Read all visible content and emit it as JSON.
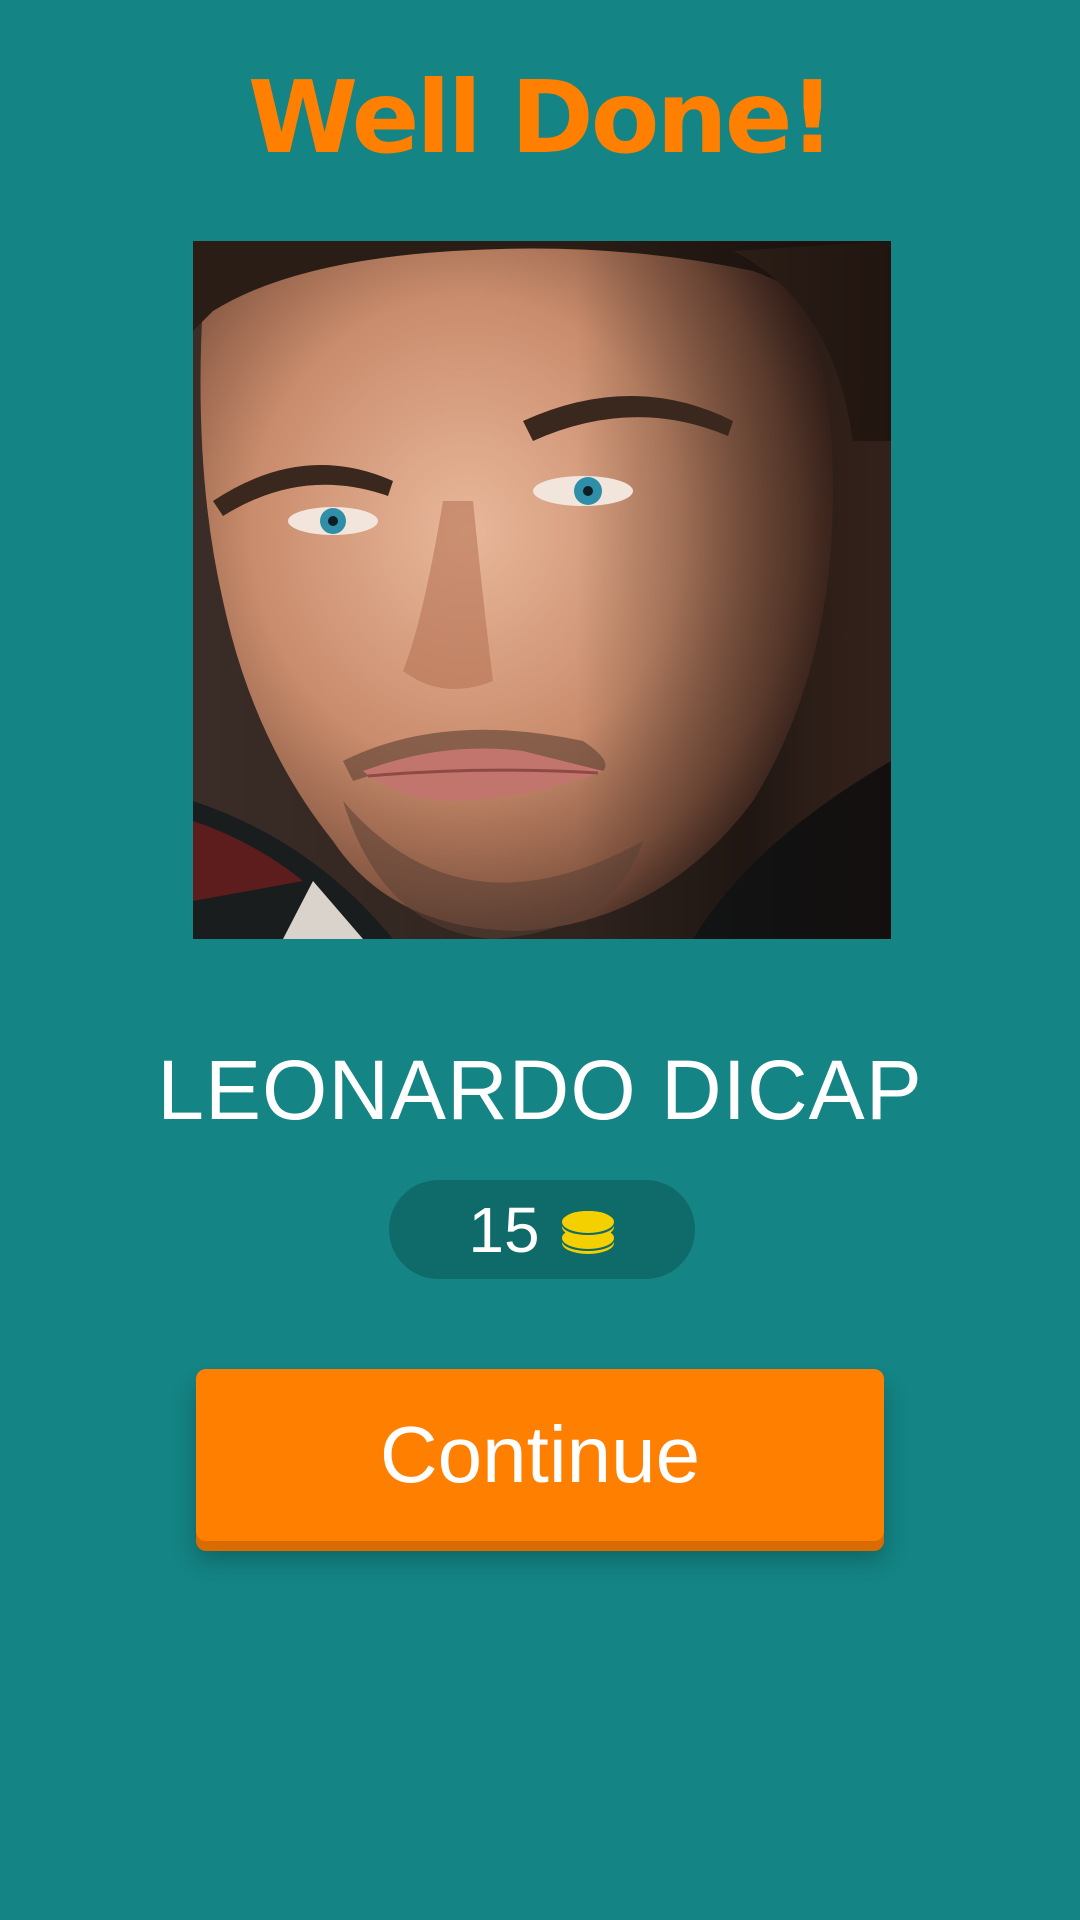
{
  "header": {
    "title": "Well Done!"
  },
  "quiz": {
    "photo_subject": "celebrity-face-photo",
    "answer": "LEONARDO DICAP"
  },
  "reward": {
    "amount": "15",
    "icon": "coins-icon"
  },
  "actions": {
    "continue_label": "Continue"
  },
  "colors": {
    "background": "#148484",
    "accent": "#ff7f00",
    "pill": "#0f6a6a",
    "coin": "#f5d000"
  }
}
